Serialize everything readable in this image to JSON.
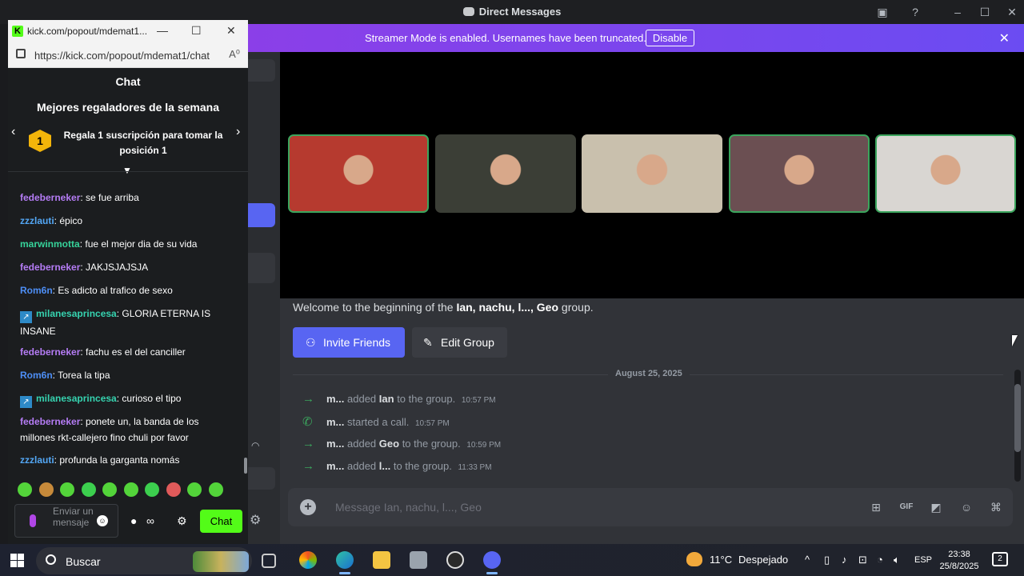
{
  "discord": {
    "window_title": "Direct Messages",
    "banner": {
      "text": "Streamer Mode is enabled. Usernames have been truncated.",
      "button": "Disable",
      "bg_color": "#7b44ee"
    },
    "welcome": {
      "prefix": "Welcome to the beginning of the ",
      "group_names": "Ian, nachu, l..., Geo",
      "suffix": " group."
    },
    "buttons": {
      "invite": "Invite Friends",
      "edit": "Edit Group"
    },
    "date_divider": "August 25, 2025",
    "system_messages": [
      {
        "icon": "arrow-right-icon",
        "actor": "m...",
        "action": "added",
        "target": "Ian",
        "rest": "to the group.",
        "time": "10:57 PM"
      },
      {
        "icon": "phone-icon",
        "actor": "m...",
        "action": "started a call.",
        "target": "",
        "rest": "",
        "time": "10:57 PM"
      },
      {
        "icon": "arrow-right-icon",
        "actor": "m...",
        "action": "added",
        "target": "Geo",
        "rest": "to the group.",
        "time": "10:59 PM"
      },
      {
        "icon": "arrow-right-icon",
        "actor": "m...",
        "action": "added",
        "target": "l...",
        "rest": "to the group.",
        "time": "11:33 PM"
      }
    ],
    "composer_placeholder": "Message Ian, nachu, l..., Geo",
    "video_tiles": [
      {
        "speaking": true,
        "bg": "#b63a2f"
      },
      {
        "speaking": false,
        "bg": "#3b3e36"
      },
      {
        "speaking": false,
        "bg": "#c9c0ad"
      },
      {
        "speaking": true,
        "bg": "#6b4f52"
      },
      {
        "speaking": true,
        "bg": "#d9d6d2"
      }
    ],
    "accent_color": "#5865f2",
    "speaking_color": "#3ba55d"
  },
  "kick": {
    "tab_title": "kick.com/popout/mdemat1...",
    "url": "https://kick.com/popout/mdemat1/chat",
    "chat_title": "Chat",
    "gifter_title": "Mejores regaladores de la semana",
    "gifter_rank": "1",
    "gifter_text": "Regala 1 suscripción para tomar la posición 1",
    "messages": [
      {
        "user": "fedeberneker",
        "color": "#b57cf5",
        "badge": false,
        "text": "se fue arriba"
      },
      {
        "user": "zzzlauti",
        "color": "#53a7f5",
        "badge": false,
        "text": "épico"
      },
      {
        "user": "marwinmotta",
        "color": "#36d39a",
        "badge": false,
        "text": "fue el mejor dia de su vida"
      },
      {
        "user": "fedeberneker",
        "color": "#b57cf5",
        "badge": false,
        "text": "JAKJSJAJSJA"
      },
      {
        "user": "Rom6n",
        "color": "#4d8ef5",
        "badge": false,
        "text": "Es adicto al trafico de sexo"
      },
      {
        "user": "milanesaprincesa",
        "color": "#36d3b0",
        "badge": true,
        "text": "GLORIA ETERNA IS INSANE"
      },
      {
        "user": "fedeberneker",
        "color": "#b57cf5",
        "badge": false,
        "text": "fachu es el del canciller"
      },
      {
        "user": "Rom6n",
        "color": "#4d8ef5",
        "badge": false,
        "text": "Torea la tipa"
      },
      {
        "user": "milanesaprincesa",
        "color": "#36d3b0",
        "badge": true,
        "text": "curioso el tipo"
      },
      {
        "user": "fedeberneker",
        "color": "#b57cf5",
        "badge": false,
        "text": "ponete un, la banda de los millones rkt-callejero fino chuli por favor"
      },
      {
        "user": "zzzlauti",
        "color": "#53a7f5",
        "badge": false,
        "text": "profunda la garganta nomás"
      }
    ],
    "input_placeholder": "Enviar un mensaje",
    "chat_button": "Chat",
    "brand_color": "#53fc18"
  },
  "taskbar": {
    "search_placeholder": "Buscar",
    "weather": "11°C",
    "weather_desc": "Despejado",
    "language": "ESP",
    "time": "23:38",
    "date": "25/8/2025",
    "notifications": "2"
  }
}
